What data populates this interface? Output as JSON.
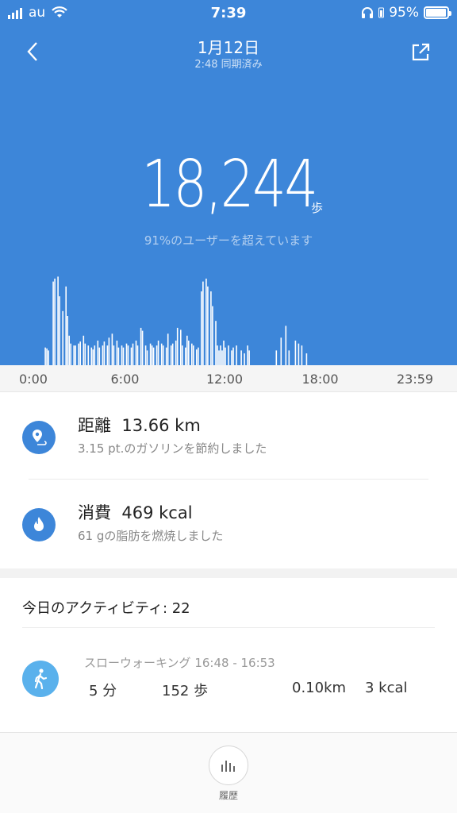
{
  "status_bar": {
    "carrier": "au",
    "time": "7:39",
    "battery": "95%"
  },
  "header": {
    "back_icon": "chevron-left-icon",
    "title": "1月12日",
    "subtitle": "2:48 同期済み",
    "share_icon": "share-icon"
  },
  "summary": {
    "steps": "18,244",
    "steps_unit": "歩",
    "percentile_text": "91%のユーザーを超えています"
  },
  "chart_data": {
    "type": "bar",
    "x": [
      0.7,
      0.8,
      0.9,
      1.2,
      1.3,
      1.5,
      1.6,
      1.8,
      2.0,
      2.1,
      2.2,
      2.3,
      2.5,
      2.6,
      2.8,
      2.9,
      3.1,
      3.2,
      3.4,
      3.6,
      3.7,
      3.8,
      4.0,
      4.1,
      4.3,
      4.4,
      4.6,
      4.7,
      4.9,
      5.0,
      5.2,
      5.3,
      5.5,
      5.6,
      5.8,
      5.9,
      6.1,
      6.2,
      6.4,
      6.5,
      6.7,
      6.8,
      7.0,
      7.1,
      7.3,
      7.4,
      7.5,
      7.7,
      7.8,
      8.0,
      8.1,
      8.3,
      8.4,
      8.6,
      8.7,
      8.9,
      9.0,
      9.2,
      9.3,
      9.5,
      9.6,
      9.7,
      9.9,
      10.0,
      10.2,
      10.3,
      10.5,
      10.6,
      10.8,
      10.9,
      11.1,
      11.2,
      11.4,
      11.5,
      11.6,
      11.7,
      11.8,
      11.9,
      12.0,
      12.2,
      12.4,
      12.5,
      12.7,
      13.0,
      13.2,
      13.4,
      13.5,
      15.2,
      15.5,
      15.8,
      16.0,
      16.4,
      16.6,
      16.8,
      17.1
    ],
    "values": [
      0.18,
      0.17,
      0.15,
      0.85,
      0.88,
      0.9,
      0.7,
      0.55,
      0.8,
      0.5,
      0.3,
      0.22,
      0.2,
      0.2,
      0.22,
      0.24,
      0.3,
      0.22,
      0.2,
      0.18,
      0.16,
      0.2,
      0.25,
      0.18,
      0.2,
      0.24,
      0.2,
      0.28,
      0.32,
      0.2,
      0.25,
      0.18,
      0.2,
      0.18,
      0.22,
      0.2,
      0.18,
      0.22,
      0.25,
      0.2,
      0.38,
      0.35,
      0.2,
      0.15,
      0.22,
      0.2,
      0.18,
      0.2,
      0.25,
      0.22,
      0.2,
      0.18,
      0.32,
      0.2,
      0.22,
      0.25,
      0.38,
      0.36,
      0.2,
      0.18,
      0.3,
      0.25,
      0.22,
      0.2,
      0.16,
      0.18,
      0.75,
      0.85,
      0.88,
      0.8,
      0.75,
      0.6,
      0.45,
      0.2,
      0.15,
      0.2,
      0.15,
      0.25,
      0.18,
      0.2,
      0.15,
      0.18,
      0.2,
      0.15,
      0.12,
      0.2,
      0.15,
      0.15,
      0.28,
      0.4,
      0.15,
      0.25,
      0.22,
      0.2,
      0.12
    ],
    "xlim": [
      0,
      24
    ],
    "ylim": [
      0,
      1
    ],
    "tick_labels": [
      "0:00",
      "6:00",
      "12:00",
      "18:00",
      "23:59"
    ],
    "color": "#ffffff",
    "grid": false
  },
  "metrics": {
    "distance": {
      "icon": "location-pin-icon",
      "label": "距離",
      "value": "13.66 km",
      "desc": "3.15 pt.のガソリンを節約しました"
    },
    "calories": {
      "icon": "flame-icon",
      "label": "消費",
      "value": "469 kcal",
      "desc": "61 gの脂肪を燃焼しました"
    }
  },
  "activities": {
    "header": "今日のアクティビティ: 22",
    "items": [
      {
        "icon": "walking-person-icon",
        "name": "スローウォーキング 16:48 - 16:53",
        "duration": "5 分",
        "steps": "152 歩",
        "distance": "0.10km",
        "calories": "3 kcal"
      }
    ]
  },
  "bottom_nav": {
    "history_icon": "bar-chart-icon",
    "history_label": "履歴"
  },
  "colors": {
    "primary_blue": "#3d86d9",
    "activity_blue": "#5ab1ec"
  }
}
